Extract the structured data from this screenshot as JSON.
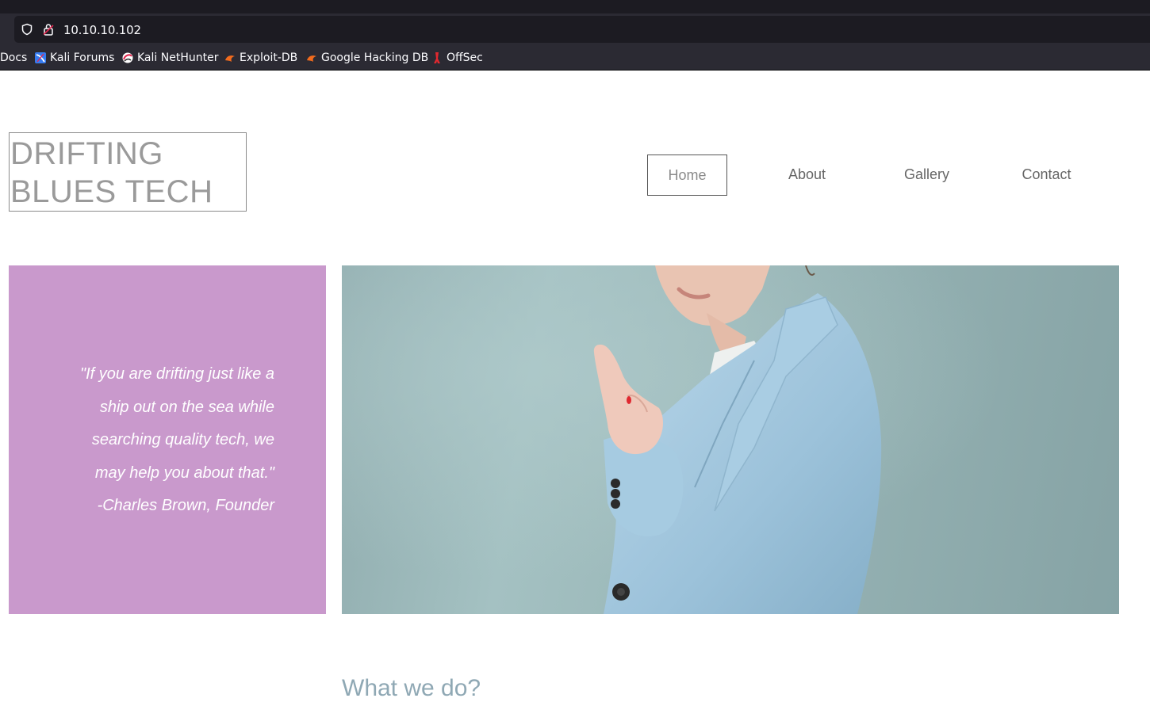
{
  "browser": {
    "url": "10.10.10.102",
    "bookmarks": [
      {
        "label": "Docs",
        "icon": "none"
      },
      {
        "label": "Kali Forums",
        "icon": "kali-forums-icon"
      },
      {
        "label": "Kali NetHunter",
        "icon": "kali-nethunter-icon"
      },
      {
        "label": "Exploit-DB",
        "icon": "exploit-db-icon"
      },
      {
        "label": "Google Hacking DB",
        "icon": "google-hacking-db-icon"
      },
      {
        "label": "OffSec",
        "icon": "offsec-icon"
      }
    ]
  },
  "site": {
    "logo_line1": "DRIFTING",
    "logo_line2": "BLUES TECH",
    "nav": {
      "home": "Home",
      "about": "About",
      "gallery": "Gallery",
      "contact": "Contact"
    },
    "quote": {
      "lines": [
        "\"If you are drifting just like a",
        "ship out on the sea while",
        "searching quality tech, we",
        "may help you about that.\""
      ],
      "author": "-Charles Brown, Founder"
    },
    "hero_image": "woman-pointing-in-light-blue-blazer",
    "section_heading": "What we do?"
  },
  "colors": {
    "quote_panel": "#c999cc",
    "hero_bg": "#9bb8b9",
    "browser_dark": "#1c1b22",
    "browser_toolbar": "#2b2a33"
  }
}
